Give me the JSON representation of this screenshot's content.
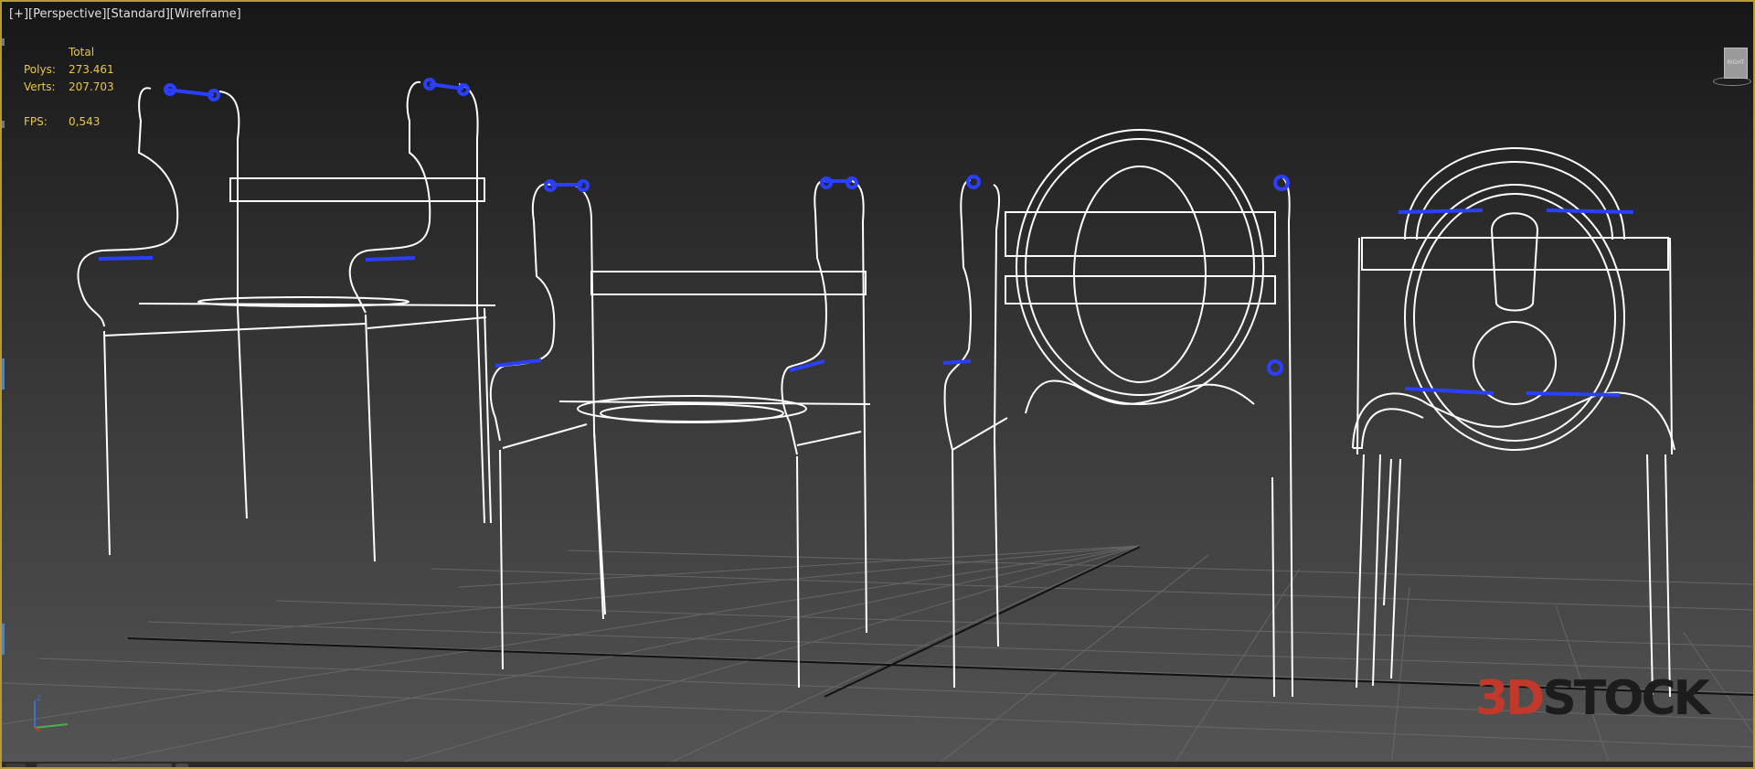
{
  "viewport": {
    "label_parts": [
      "[+]",
      "[Perspective]",
      "[Standard]",
      "[Wireframe]"
    ],
    "frame_color": "#b59a3c",
    "background_color": "#3a3a3a"
  },
  "stats": {
    "header": "Total",
    "polys_label": "Polys:",
    "polys_value": "273.461",
    "verts_label": "Verts:",
    "verts_value": "207.703",
    "fps_label": "FPS:",
    "fps_value": "0,543",
    "color": "#e6c84a"
  },
  "viewcube": {
    "face_text": "RIGHT"
  },
  "axis_gizmo": {
    "z_label": "z",
    "x_color": "#c0392b",
    "y_color": "#4caf50",
    "z_color": "#3b6fd6"
  },
  "watermark": {
    "text_part1": "3D",
    "text_part2": "STOCK"
  },
  "scene": {
    "objects": [
      "chair-model-1",
      "chair-model-2",
      "chair-model-3",
      "chair-model-4"
    ],
    "wire_color": "#ffffff",
    "selection_color": "#2a3fff"
  }
}
